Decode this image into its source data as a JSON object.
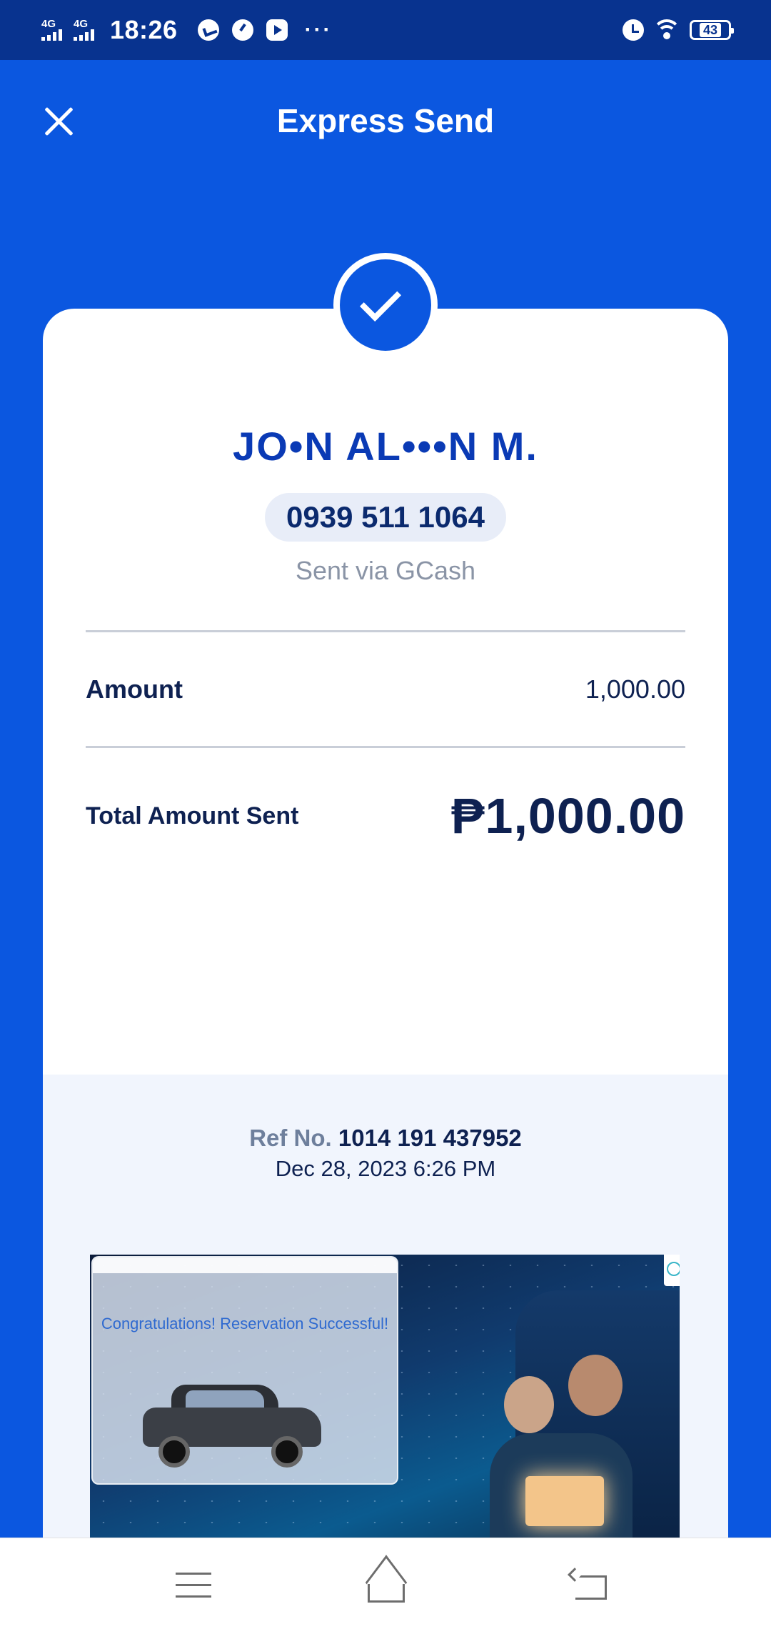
{
  "status_bar": {
    "network_1": "4G",
    "network_2": "4G",
    "time": "18:26",
    "dots": "···",
    "battery": "43"
  },
  "header": {
    "title": "Express Send"
  },
  "receipt": {
    "recipient_name": "JO•N AL•••N M.",
    "phone_number": "0939 511 1064",
    "sent_via": "Sent via GCash",
    "amount_label": "Amount",
    "amount_value": "1,000.00",
    "total_label": "Total Amount Sent",
    "total_value": "₱1,000.00",
    "ref_label": "Ref No.",
    "ref_number": "1014 191 437952",
    "datetime": "Dec 28, 2023 6:26 PM"
  },
  "ad": {
    "headline": "Congratulations! Reservation Successful!"
  },
  "colors": {
    "primary": "#0b57e0",
    "status_bar": "#08338f",
    "dark_text": "#0e2151",
    "name_blue": "#0a3ab5",
    "ref_bg": "#f1f5fd"
  },
  "icons": {
    "close": "close-icon",
    "success": "check-icon",
    "nav_menu": "menu-icon",
    "nav_home": "home-icon",
    "nav_back": "back-icon"
  }
}
